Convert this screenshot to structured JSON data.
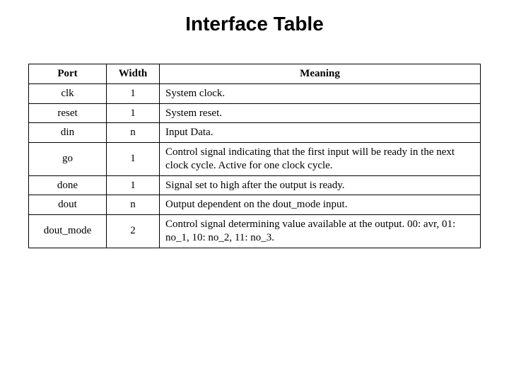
{
  "title": "Interface Table",
  "headers": {
    "port": "Port",
    "width": "Width",
    "meaning": "Meaning"
  },
  "rows": [
    {
      "port": "clk",
      "width": "1",
      "meaning": "System clock."
    },
    {
      "port": "reset",
      "width": "1",
      "meaning": "System reset."
    },
    {
      "port": "din",
      "width": "n",
      "meaning": "Input Data."
    },
    {
      "port": "go",
      "width": "1",
      "meaning": "Control signal indicating that the first input will be ready in the next clock cycle. Active for one clock cycle."
    },
    {
      "port": "done",
      "width": "1",
      "meaning": "Signal set to high after the output is ready."
    },
    {
      "port": "dout",
      "width": "n",
      "meaning": "Output dependent on the dout_mode input."
    },
    {
      "port": "dout_mode",
      "width": "2",
      "meaning": "Control signal determining value available at the output. 00: avr, 01: no_1, 10: no_2, 11: no_3."
    }
  ]
}
